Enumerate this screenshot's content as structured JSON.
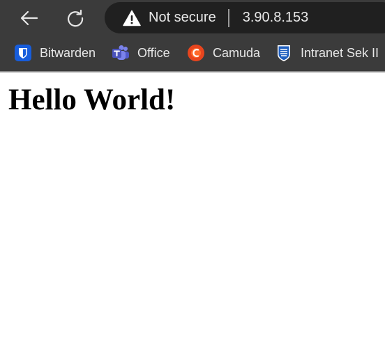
{
  "toolbar": {
    "back_icon": "back-arrow-icon",
    "reload_icon": "reload-icon"
  },
  "address_bar": {
    "security_icon": "warning-triangle-icon",
    "security_text": "Not secure",
    "url": "3.90.8.153"
  },
  "bookmarks": [
    {
      "label": "Bitwarden",
      "icon": "bitwarden-icon"
    },
    {
      "label": "Office",
      "icon": "teams-icon"
    },
    {
      "label": "Camuda",
      "icon": "camuda-icon"
    },
    {
      "label": "Intranet Sek II",
      "icon": "intranet-icon"
    }
  ],
  "page": {
    "heading": "Hello World!"
  },
  "colors": {
    "chrome_background": "#3b3b3b",
    "address_bar_background": "#202020",
    "chrome_text": "#e8e8e8",
    "page_background": "#ffffff"
  }
}
